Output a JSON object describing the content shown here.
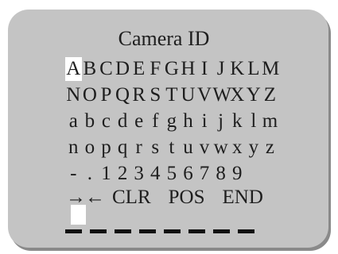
{
  "osd": {
    "title": "Camera ID",
    "char_rows": [
      [
        "A",
        "B",
        "C",
        "D",
        "E",
        "F",
        "G",
        "H",
        "I",
        "J",
        "K",
        "L",
        "M"
      ],
      [
        "N",
        "O",
        "P",
        "Q",
        "R",
        "S",
        "T",
        "U",
        "V",
        "W",
        "X",
        "Y",
        "Z"
      ],
      [
        "a",
        "b",
        "c",
        "d",
        "e",
        "f",
        "g",
        "h",
        "i",
        "j",
        "k",
        "l",
        "m"
      ],
      [
        "n",
        "o",
        "p",
        "q",
        "r",
        "s",
        "t",
        "u",
        "v",
        "w",
        "x",
        "y",
        "z"
      ],
      [
        "-",
        ".",
        "1",
        "2",
        "3",
        "4",
        "5",
        "6",
        "7",
        "8",
        "9",
        "",
        ""
      ]
    ],
    "selected_char": "A",
    "controls": {
      "right_arrow": "→",
      "left_arrow": "←",
      "clear": "CLR",
      "position": "POS",
      "end": "END"
    },
    "entry_value": "",
    "entry_slot_count": 8
  }
}
